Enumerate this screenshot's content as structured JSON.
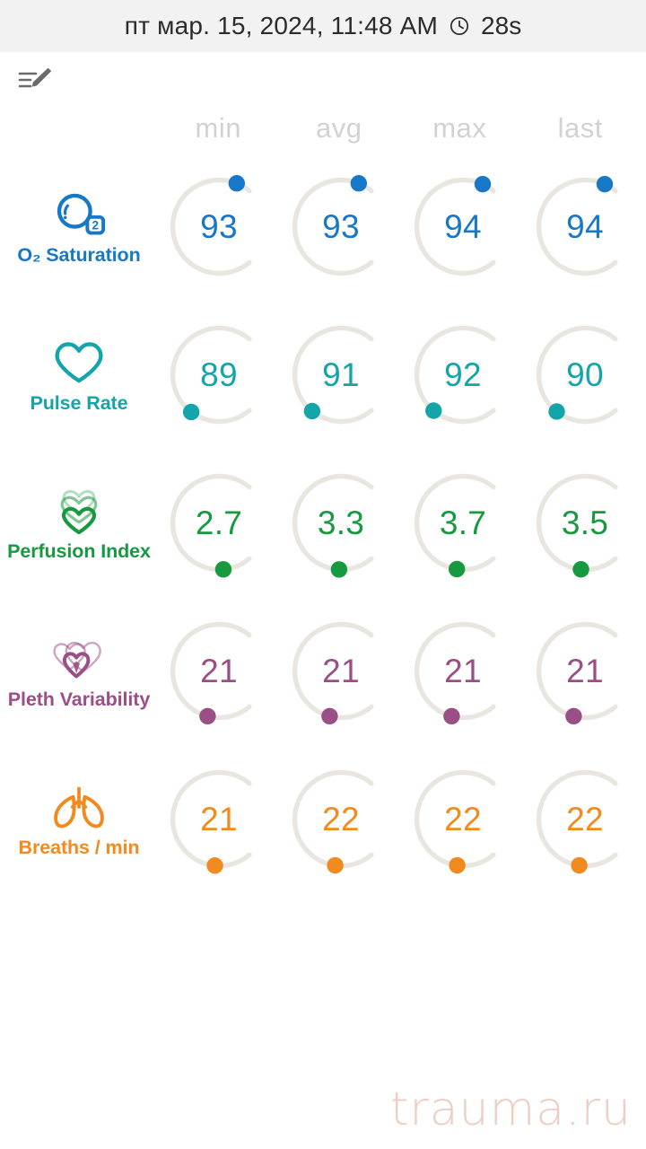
{
  "statusbar": {
    "datetime": "пт мар. 15, 2024, 11:48 AM",
    "clock_icon": "clock-icon",
    "elapsed": "28s"
  },
  "toolbar": {
    "edit_icon": "edit-note-icon"
  },
  "columns": [
    "min",
    "avg",
    "max",
    "last"
  ],
  "metrics": [
    {
      "id": "o2-saturation",
      "label": "O₂ Saturation",
      "icon": "o2-bubble-icon",
      "color": "#1878c8",
      "range": [
        0,
        100
      ],
      "values": [
        "93",
        "93",
        "94",
        "94"
      ],
      "numeric": [
        93,
        93,
        94,
        94
      ]
    },
    {
      "id": "pulse-rate",
      "label": "Pulse Rate",
      "icon": "heart-icon",
      "color": "#14a5ab",
      "range": [
        0,
        300
      ],
      "values": [
        "89",
        "91",
        "92",
        "90"
      ],
      "numeric": [
        89,
        91,
        92,
        90
      ]
    },
    {
      "id": "perfusion-index",
      "label": "Perfusion Index",
      "icon": "triple-heart-icon",
      "color": "#17993f",
      "range": [
        0,
        20
      ],
      "values": [
        "2.7",
        "3.3",
        "3.7",
        "3.5"
      ],
      "numeric": [
        2.7,
        3.3,
        3.7,
        3.5
      ]
    },
    {
      "id": "pleth-variability",
      "label": "Pleth Variability",
      "icon": "double-heart-icon",
      "color": "#9a4f86",
      "range": [
        0,
        100
      ],
      "values": [
        "21",
        "21",
        "21",
        "21"
      ],
      "numeric": [
        21,
        21,
        21,
        21
      ]
    },
    {
      "id": "breaths-per-min",
      "label": "Breaths / min",
      "icon": "lungs-icon",
      "color": "#f18a1f",
      "range": [
        0,
        120
      ],
      "values": [
        "21",
        "22",
        "22",
        "22"
      ],
      "numeric": [
        21,
        22,
        22,
        22
      ]
    }
  ],
  "watermark": "trauma.ru",
  "palette": {
    "track": "#e9e6e0",
    "header_bg": "#f2f2f2",
    "column_header": "#d2d2d2",
    "page_bg": "#ffffff"
  }
}
